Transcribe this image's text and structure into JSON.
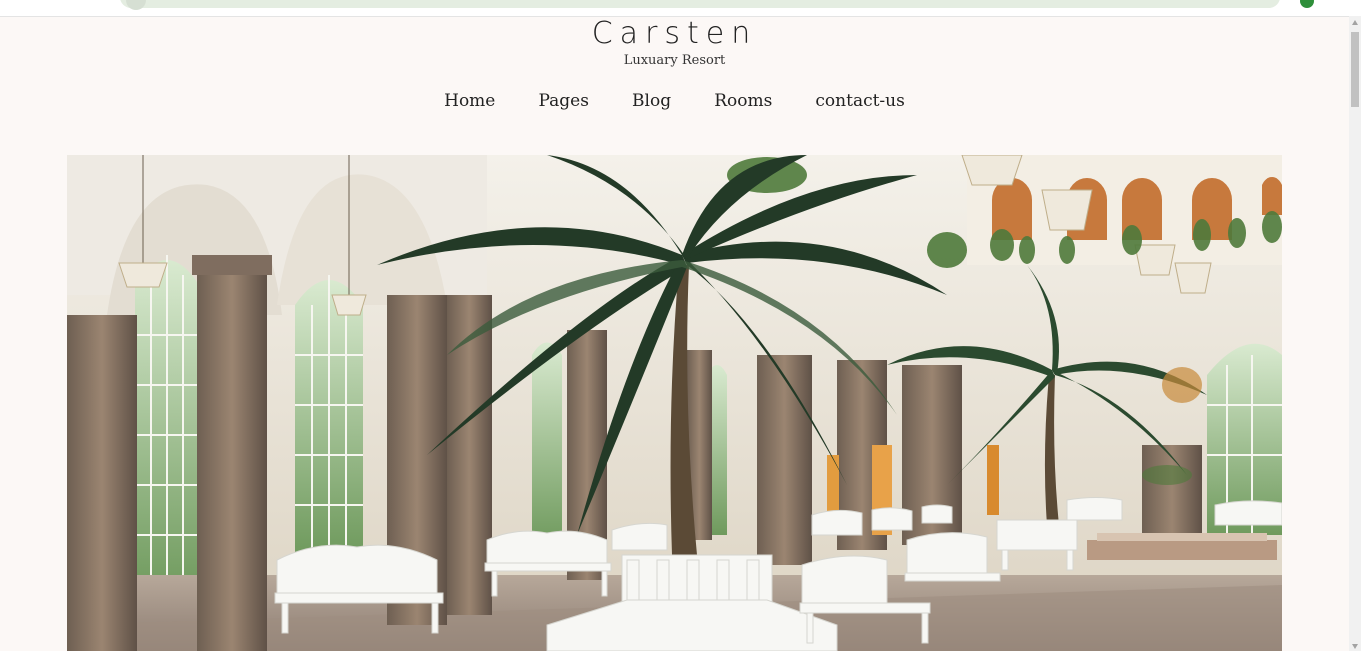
{
  "site": {
    "name": "Carsten",
    "tagline": "Luxuary Resort"
  },
  "nav": {
    "items": [
      {
        "label": "Home"
      },
      {
        "label": "Pages"
      },
      {
        "label": "Blog"
      },
      {
        "label": "Rooms"
      },
      {
        "label": "contact-us"
      }
    ]
  },
  "hero": {
    "image": "palm-court-hall-photo"
  }
}
